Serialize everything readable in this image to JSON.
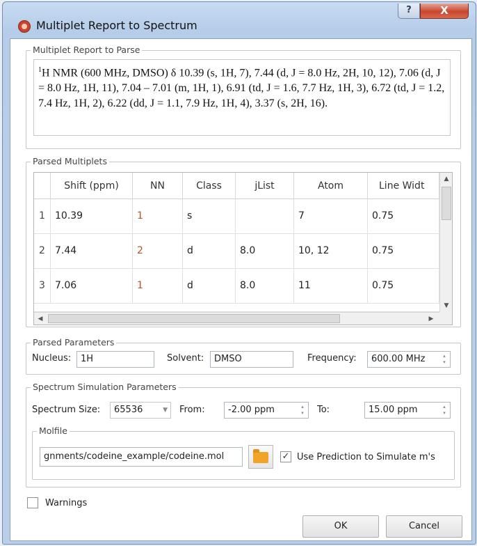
{
  "window": {
    "title": "Multiplet Report to Spectrum",
    "help_glyph": "?",
    "close_glyph": "X"
  },
  "report": {
    "group_title": "Multiplet Report to Parse",
    "superscript": "1",
    "text": "H NMR (600 MHz, DMSO) δ 10.39 (s, 1H, 7), 7.44 (d, J = 8.0 Hz, 2H, 10, 12), 7.06 (d, J = 8.0 Hz, 1H, 11), 7.04 – 7.01 (m, 1H, 1), 6.91 (td, J = 1.6, 7.7 Hz, 1H, 3), 6.72 (td, J = 1.2, 7.4 Hz, 1H, 2), 6.22 (dd, J = 1.1, 7.9 Hz, 1H, 4), 3.37 (s, 2H, 16)."
  },
  "multiplets": {
    "group_title": "Parsed Multiplets",
    "columns": [
      "Shift (ppm)",
      "NN",
      "Class",
      "jList",
      "Atom",
      "Line Widt"
    ],
    "rows": [
      {
        "n": "1",
        "shift": "10.39",
        "nn": "1",
        "class": "s",
        "jlist": "",
        "atom": "7",
        "width": "0.75"
      },
      {
        "n": "2",
        "shift": "7.44",
        "nn": "2",
        "class": "d",
        "jlist": "8.0",
        "atom": "10, 12",
        "width": "0.75"
      },
      {
        "n": "3",
        "shift": "7.06",
        "nn": "1",
        "class": "d",
        "jlist": "8.0",
        "atom": "11",
        "width": "0.75"
      }
    ]
  },
  "parameters": {
    "group_title": "Parsed Parameters",
    "nucleus_label": "Nucleus:",
    "nucleus": "1H",
    "solvent_label": "Solvent:",
    "solvent": "DMSO",
    "frequency_label": "Frequency:",
    "frequency": "600.00 MHz"
  },
  "simulation": {
    "group_title": "Spectrum Simulation Parameters",
    "size_label": "Spectrum Size:",
    "size": "65536",
    "from_label": "From:",
    "from": "-2.00 ppm",
    "to_label": "To:",
    "to": "15.00 ppm",
    "molfile_title": "Molfile",
    "molfile_path": "gnments/codeine_example/codeine.mol",
    "use_prediction_label": "Use Prediction to Simulate m's",
    "use_prediction_checked": true
  },
  "warnings_label": "Warnings",
  "buttons": {
    "ok": "OK",
    "cancel": "Cancel"
  },
  "glyphs": {
    "check": "✓",
    "up": "▲",
    "down": "▼",
    "left": "◀",
    "right": "▶",
    "spin_up": "▴",
    "spin_down": "▾",
    "combo": "▼"
  }
}
